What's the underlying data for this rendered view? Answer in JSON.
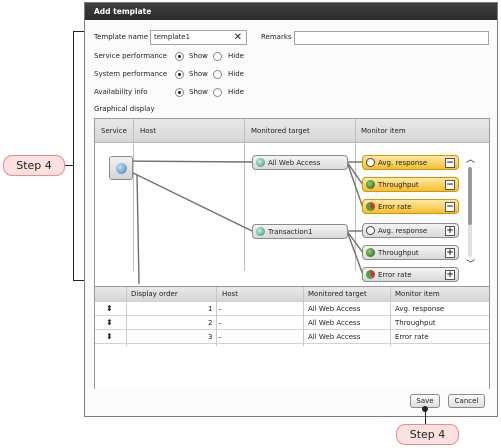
{
  "dialog": {
    "title": "Add template"
  },
  "form": {
    "template_name_label": "Template name",
    "template_name_value": "template1",
    "remarks_label": "Remarks",
    "remarks_value": "",
    "rows": [
      {
        "label": "Service performance",
        "show": "Show",
        "hide": "Hide",
        "selected": "Show"
      },
      {
        "label": "System performance",
        "show": "Show",
        "hide": "Hide",
        "selected": "Show"
      },
      {
        "label": "Availability info",
        "show": "Show",
        "hide": "Hide",
        "selected": "Show"
      }
    ],
    "graphical_display_label": "Graphical display"
  },
  "graph": {
    "headers": [
      "Service",
      "Host",
      "Monitored target",
      "Monitor item"
    ],
    "targets": [
      "All Web Access",
      "Transaction1"
    ],
    "items_group1": [
      {
        "label": "Avg. response",
        "icon": "stopwatch-icon",
        "selected": true,
        "button": "−"
      },
      {
        "label": "Throughput",
        "icon": "throughput-icon",
        "selected": true,
        "button": "−"
      },
      {
        "label": "Error rate",
        "icon": "error-rate-icon",
        "selected": true,
        "button": "−"
      }
    ],
    "items_group2": [
      {
        "label": "Avg. response",
        "icon": "stopwatch-icon",
        "selected": false,
        "button": "+"
      },
      {
        "label": "Throughput",
        "icon": "throughput-icon",
        "selected": false,
        "button": "+"
      },
      {
        "label": "Error rate",
        "icon": "error-rate-icon",
        "selected": false,
        "button": "+"
      }
    ]
  },
  "table": {
    "headers": [
      "",
      "Display order",
      "Host",
      "Monitored target",
      "Monitor item"
    ],
    "rows": [
      {
        "order": "1",
        "host": "–",
        "target": "All Web Access",
        "item": "Avg. response"
      },
      {
        "order": "2",
        "host": "–",
        "target": "All Web Access",
        "item": "Throughput"
      },
      {
        "order": "3",
        "host": "–",
        "target": "All Web Access",
        "item": "Error rate"
      }
    ]
  },
  "buttons": {
    "save": "Save",
    "cancel": "Cancel"
  },
  "callouts": {
    "left": "Step 4",
    "bottom": "Step 4"
  },
  "colors": {
    "selected_item": "#f7be2e",
    "callout_fill": "#fde0e0",
    "title_bar": "#333333"
  }
}
